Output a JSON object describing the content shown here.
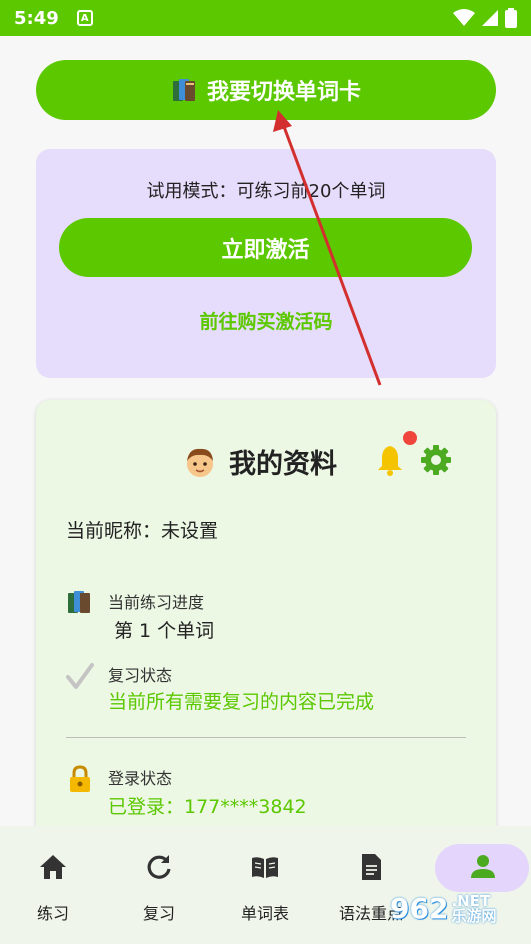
{
  "status_bar": {
    "time": "5:49",
    "notification_letter": "A"
  },
  "switch_button": {
    "label": "我要切换单词卡",
    "icon": "book-icon"
  },
  "trial": {
    "mode_text": "试用模式：可练习前20个单词",
    "activate_label": "立即激活",
    "buy_link": "前往购买激活码"
  },
  "profile": {
    "title": "我的资料",
    "nickname": "当前昵称：未设置",
    "progress": {
      "label": "当前练习进度",
      "value": "第 1 个单词"
    },
    "review": {
      "label": "复习状态",
      "value": "当前所有需要复习的内容已完成"
    },
    "login": {
      "label": "登录状态",
      "value": "已登录：177****3842"
    }
  },
  "bottom_nav": {
    "items": [
      {
        "label": "练习",
        "icon": "home-icon"
      },
      {
        "label": "复习",
        "icon": "refresh-icon"
      },
      {
        "label": "单词表",
        "icon": "open-book-icon"
      },
      {
        "label": "语法重点",
        "icon": "document-icon"
      },
      {
        "label": "",
        "icon": "person-icon",
        "active": true
      }
    ]
  },
  "watermark": {
    "text": "962",
    "suffix": ".NET",
    "sub": "乐游网"
  },
  "colors": {
    "primary_green": "#5cc800",
    "trial_bg": "#e6dcfb",
    "profile_bg": "#ecf7e4",
    "annotation_red": "#d32f2f"
  }
}
